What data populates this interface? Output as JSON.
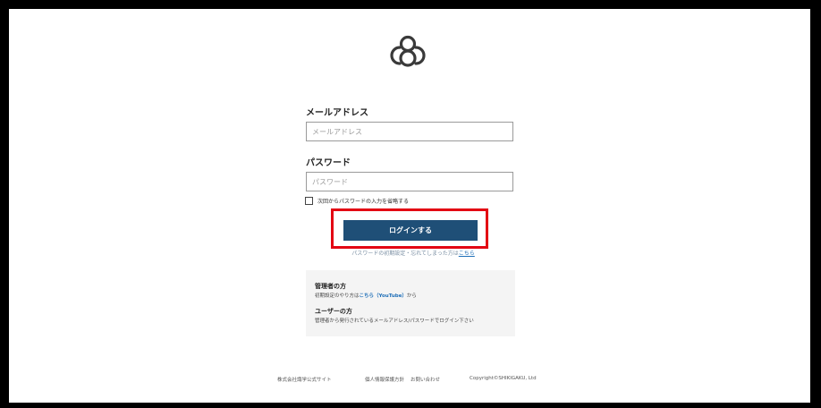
{
  "login": {
    "email_label": "メールアドレス",
    "email_placeholder": "メールアドレス",
    "password_label": "パスワード",
    "password_placeholder": "パスワード",
    "remember_label": "次回からパスワードの入力を省略する",
    "login_button": "ログインする",
    "forgot_text": "パスワードの初期設定・忘れてしまった方は",
    "forgot_link": "こちら"
  },
  "info": {
    "admin_title": "管理者の方",
    "admin_text_prefix": "初期設定のやり方は",
    "admin_link": "こちら（YouTube）",
    "admin_text_suffix": "から",
    "user_title": "ユーザーの方",
    "user_text": "管理者から発行されているメールアドレス/パスワードでログイン下さい"
  },
  "footer": {
    "corporate_site": "株式会社識学公式サイト",
    "privacy_policy": "個人情報保護方針",
    "contact": "お問い合わせ",
    "copyright": "Copyright©SHIKIGAKU, Ltd"
  },
  "colors": {
    "button": "#1f4f77",
    "highlight": "#e30613",
    "link": "#1f6fb8"
  },
  "icons": {
    "logo": "shikigaku-logo-icon",
    "checkbox": "checkbox-unchecked"
  }
}
